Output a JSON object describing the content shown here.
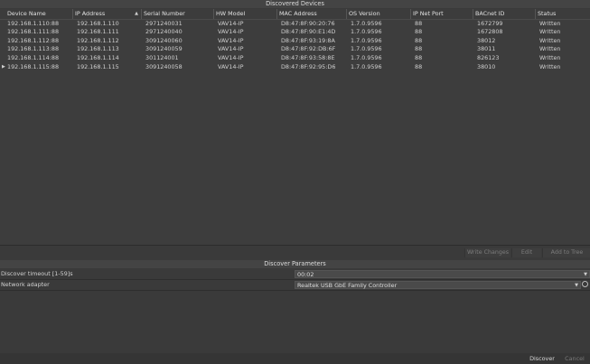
{
  "titles": {
    "discovered_devices": "Discovered Devices",
    "discover_parameters": "Discover Parameters"
  },
  "columns": [
    "Device Name",
    "IP Address",
    "Serial Number",
    "HW Model",
    "MAC Address",
    "OS Version",
    "IP Net Port",
    "BACnet ID",
    "Status"
  ],
  "rows": [
    [
      "192.168.1.110:88",
      "192.168.1.110",
      "2971240031",
      "VAV14-IP",
      "D8:47:8F:90:20:76",
      "1.7.0.9596",
      "88",
      "1672799",
      "Written"
    ],
    [
      "192.168.1.111:88",
      "192.168.1.111",
      "2971240040",
      "VAV14-IP",
      "D8:47:8F:90:E1:4D",
      "1.7.0.9596",
      "88",
      "1672808",
      "Written"
    ],
    [
      "192.168.1.112:88",
      "192.168.1.112",
      "3091240060",
      "VAV14-IP",
      "D8:47:8F:93:19:8A",
      "1.7.0.9596",
      "88",
      "38012",
      "Written"
    ],
    [
      "192.168.1.113:88",
      "192.168.1.113",
      "3091240059",
      "VAV14-IP",
      "D8:47:8F:92:DB:6F",
      "1.7.0.9596",
      "88",
      "38011",
      "Written"
    ],
    [
      "192.168.1.114:88",
      "192.168.1.114",
      "301124001",
      "VAV14-IP",
      "D8:47:8F:93:58:8E",
      "1.7.0.9596",
      "88",
      "826123",
      "Written"
    ],
    [
      "192.168.1.115:88",
      "192.168.1.115",
      "3091240058",
      "VAV14-IP",
      "D8:47:8F:92:95:D6",
      "1.7.0.9596",
      "88",
      "38010",
      "Written"
    ]
  ],
  "toolbar": {
    "write_changes": "Write Changes",
    "edit": "Edit",
    "add_to_tree": "Add to Tree"
  },
  "params": {
    "timeout_label": "Discover timeout [1-59]s",
    "timeout_value": "00:02",
    "adapter_label": "Network adapter",
    "adapter_value": "Realtek USB GbE Family Controller"
  },
  "bottom": {
    "discover": "Discover",
    "cancel": "Cancel"
  },
  "icons": {
    "sort": "sort-ascending-icon",
    "row_current": "row-pointer-icon",
    "dropdown": "chevron-down-icon",
    "refresh": "refresh-icon"
  }
}
